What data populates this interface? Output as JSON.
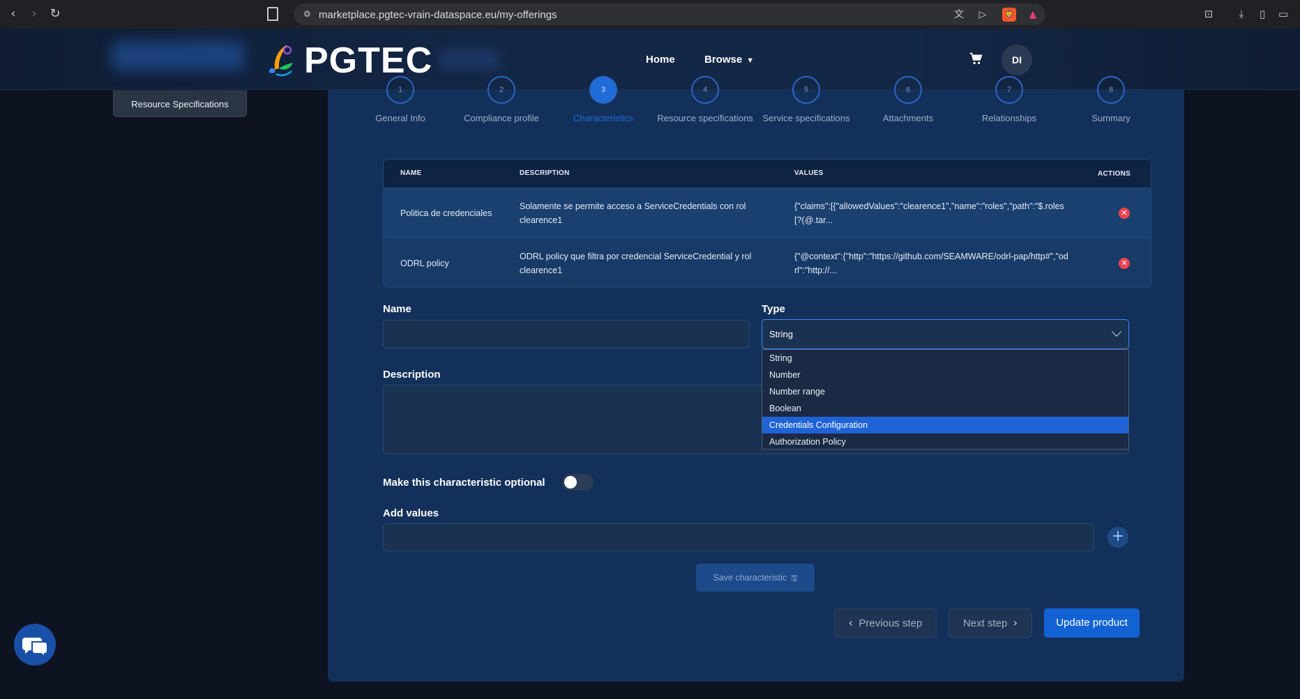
{
  "browser": {
    "url": "marketplace.pgtec-vrain-dataspace.eu/my-offerings",
    "badge_count": "1"
  },
  "header": {
    "brand": "PGTEC",
    "nav": [
      {
        "label": "Home"
      },
      {
        "label": "Browse",
        "caret": "▼"
      }
    ],
    "avatar_initials": "DI"
  },
  "side": {
    "pill_label": "Resource Specifications"
  },
  "stepper": {
    "steps": [
      {
        "num": "1",
        "label": "General Info"
      },
      {
        "num": "2",
        "label": "Compliance profile"
      },
      {
        "num": "3",
        "label": "Characteristics"
      },
      {
        "num": "4",
        "label": "Resource specifications"
      },
      {
        "num": "5",
        "label": "Service specifications"
      },
      {
        "num": "6",
        "label": "Attachments"
      },
      {
        "num": "7",
        "label": "Relationships"
      },
      {
        "num": "8",
        "label": "Summary"
      }
    ],
    "active_index": 2
  },
  "table": {
    "headers": {
      "name": "NAME",
      "description": "DESCRIPTION",
      "values": "VALUES",
      "actions": "ACTIONS"
    },
    "rows": [
      {
        "name": "Politica de credenciales",
        "description": "Solamente se permite acceso a ServiceCredentials con rol clearence1",
        "values": "{\"claims\":[{\"allowedValues\":\"clearence1\",\"name\":\"roles\",\"path\":\"$.roles[?(@.tar..."
      },
      {
        "name": "ODRL policy",
        "description": "ODRL policy que filtra por credencial ServiceCredential y rol clearence1",
        "values": "{\"@context\":{\"http\":\"https://github.com/SEAMWARE/odrl-pap/http#\",\"odrl\":\"http://..."
      }
    ]
  },
  "form": {
    "name_label": "Name",
    "name_value": "",
    "type_label": "Type",
    "type_value": "String",
    "type_options": [
      "String",
      "Number",
      "Number range",
      "Boolean",
      "Credentials Configuration",
      "Authorization Policy"
    ],
    "highlighted_option": "Credentials Configuration",
    "description_label": "Description",
    "description_value": "",
    "optional_label": "Make this characteristic optional",
    "optional_on": false,
    "add_values_label": "Add values",
    "add_values_value": "",
    "save_label": "Save characteristic"
  },
  "footer": {
    "prev_label": "Previous step",
    "next_label": "Next step",
    "update_label": "Update product"
  },
  "colors": {
    "accent": "#1262d3",
    "panel": "#12305a",
    "danger": "#f0424f"
  }
}
